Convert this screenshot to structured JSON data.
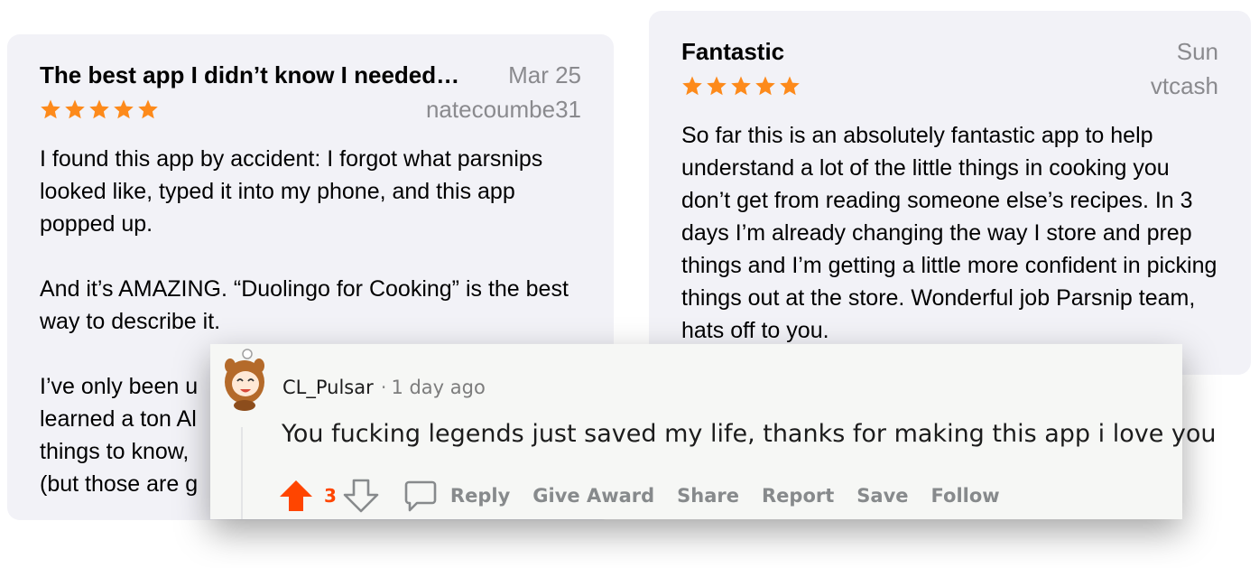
{
  "reviews": [
    {
      "title": "The best app I didn’t know I needed…",
      "date": "Mar 25",
      "author": "natecoumbe31",
      "rating": 5,
      "paragraphs": [
        "I found this app by accident: I forgot what parsnips looked like, typed it into my phone, and this app popped up.",
        "And it’s AMAZING. “Duolingo for Cooking” is the best way to describe it.",
        "I’ve only been u\nlearned a ton Al\nthings to know,\n(but those are g"
      ]
    },
    {
      "title": "Fantastic",
      "date": "Sun",
      "author": "vtcash",
      "rating": 5,
      "paragraphs": [
        "So far this is an absolutely fantastic app to help understand a lot of the little things in cooking you don’t get from reading someone else’s recipes. In 3 days I’m already changing the way I store and prep things and I’m getting a little more confident in picking things out at the store. Wonderful job Parsnip team, hats off to you."
      ]
    }
  ],
  "comment": {
    "username": "CL_Pulsar",
    "separator": "·",
    "time_ago": "1 day ago",
    "text": "You fucking legends just saved my life, thanks for making this app i love you",
    "score": "3",
    "actions": {
      "reply": "Reply",
      "give_award": "Give Award",
      "share": "Share",
      "report": "Report",
      "save": "Save",
      "follow": "Follow"
    }
  },
  "colors": {
    "star": "#fd8a1b",
    "upvote": "#ff4500",
    "action_gray": "#878a8c",
    "card_bg": "#f2f2f7"
  }
}
